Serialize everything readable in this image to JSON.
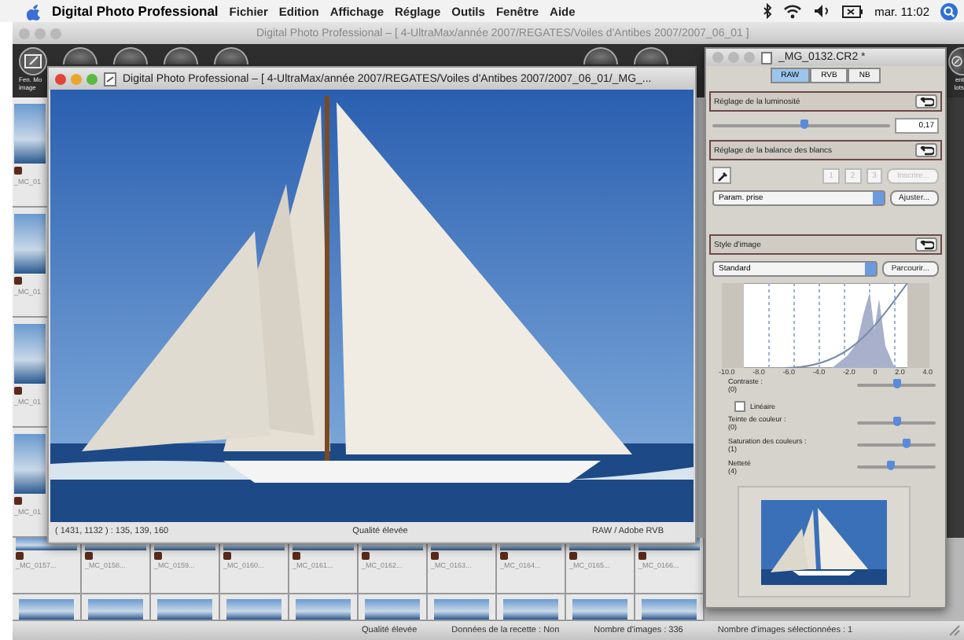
{
  "menu_bar": {
    "app": "Digital Photo Professional",
    "menus": [
      "Fichier",
      "Edition",
      "Affichage",
      "Réglage",
      "Outils",
      "Fenêtre",
      "Aide"
    ],
    "clock": "mar. 11:02"
  },
  "main_window": {
    "title": "Digital Photo Professional – [ 4-UltraMax/année 2007/REGATES/Voiles d'Antibes 2007/2007_06_01 ]",
    "toolbar_left_label": "Fen. Mo\nimage",
    "toolbar_right_label": "ent\nlots"
  },
  "side_thumbnails": [
    {
      "label": "_MC_01"
    },
    {
      "label": "_MC_01"
    },
    {
      "label": "_MC_01"
    },
    {
      "label": "_MC_01"
    }
  ],
  "thumbnails": [
    {
      "label": "_MC_0157..."
    },
    {
      "label": "_MC_0158..."
    },
    {
      "label": "_MC_0159..."
    },
    {
      "label": "_MC_0160..."
    },
    {
      "label": "_MC_0161..."
    },
    {
      "label": "_MC_0162..."
    },
    {
      "label": "_MC_0163..."
    },
    {
      "label": "_MC_0164..."
    },
    {
      "label": "_MC_0165..."
    },
    {
      "label": "_MC_0166..."
    }
  ],
  "status_bar": [
    "Qualité élevée",
    "Données de la recette : Non",
    "Nombre d'images : 336",
    "Nombre d'images sélectionnées : 1"
  ],
  "image_window": {
    "title": "Digital Photo Professional – [ 4-UltraMax/année 2007/REGATES/Voiles d'Antibes 2007/2007_06_01/_MG_...",
    "status": [
      "( 1431, 1132 ) : 135, 139, 160",
      "Qualité élevée",
      "RAW / Adobe RVB"
    ]
  },
  "tool_palette": {
    "title": "_MG_0132.CR2 *",
    "tabs": [
      {
        "label": "RAW",
        "selected": true
      },
      {
        "label": "RVB",
        "selected": false
      },
      {
        "label": "NB",
        "selected": false
      }
    ],
    "brightness": {
      "heading": "Réglage de la luminosité",
      "level": 0.52,
      "value": "0,17"
    },
    "white_balance": {
      "heading": "Réglage de la balance des blancs",
      "buttons": [
        {
          "label": "1",
          "disabled": true
        },
        {
          "label": "2",
          "disabled": true
        },
        {
          "label": "3",
          "disabled": true
        },
        {
          "label": "Inscrire...",
          "disabled": true
        }
      ],
      "preset": "Param. prise",
      "adjust": {
        "label": "Ajuster...",
        "disabled": false
      }
    },
    "picture_style": {
      "heading": "Style d'image",
      "style": "Standard",
      "browse": "Parcourir...",
      "histogram_ticks": [
        "-10.0",
        "-8.0",
        "-6.0",
        "-4.0",
        "-2.0",
        "0",
        "2.0",
        "4.0"
      ],
      "controls": [
        {
          "kind": "slider",
          "label": "Contraste :",
          "value": "(0)",
          "level": 0.5
        },
        {
          "kind": "checkbox",
          "label": "Linéaire",
          "checked": false
        },
        {
          "kind": "slider",
          "label": "Teinte de couleur :",
          "value": "(0)",
          "level": 0.5
        },
        {
          "kind": "slider",
          "label": "Saturation des couleurs :",
          "value": "(1)",
          "level": 0.62
        },
        {
          "kind": "slider",
          "label": "Netteté",
          "value": "(4)",
          "level": 0.42
        }
      ]
    }
  }
}
